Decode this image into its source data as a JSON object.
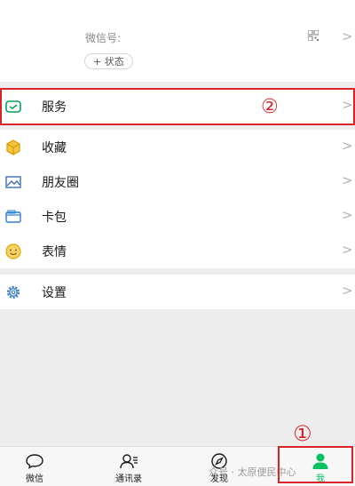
{
  "profile": {
    "wechat_id_label": "微信号:",
    "status_button": "+ 状态"
  },
  "menu": {
    "group1": [
      {
        "label": "服务",
        "icon": "service-icon"
      }
    ],
    "group2": [
      {
        "label": "收藏",
        "icon": "favorites-cube-icon"
      },
      {
        "label": "朋友圈",
        "icon": "moments-picture-icon"
      },
      {
        "label": "卡包",
        "icon": "card-wallet-icon"
      },
      {
        "label": "表情",
        "icon": "sticker-smiley-icon"
      }
    ],
    "group3": [
      {
        "label": "设置",
        "icon": "settings-gear-icon"
      }
    ]
  },
  "annotations": {
    "marker_1": "①",
    "marker_2": "②",
    "highlight_color": "#d9242a"
  },
  "tabbar": {
    "tabs": [
      {
        "label": "微信",
        "icon": "chat-bubble-icon",
        "active": false
      },
      {
        "label": "通讯录",
        "icon": "contacts-icon",
        "active": false
      },
      {
        "label": "发现",
        "icon": "compass-icon",
        "active": false
      },
      {
        "label": "我",
        "icon": "person-icon",
        "active": true
      }
    ],
    "active_color": "#07c160"
  },
  "watermark": "众号 · 太原便民中心"
}
